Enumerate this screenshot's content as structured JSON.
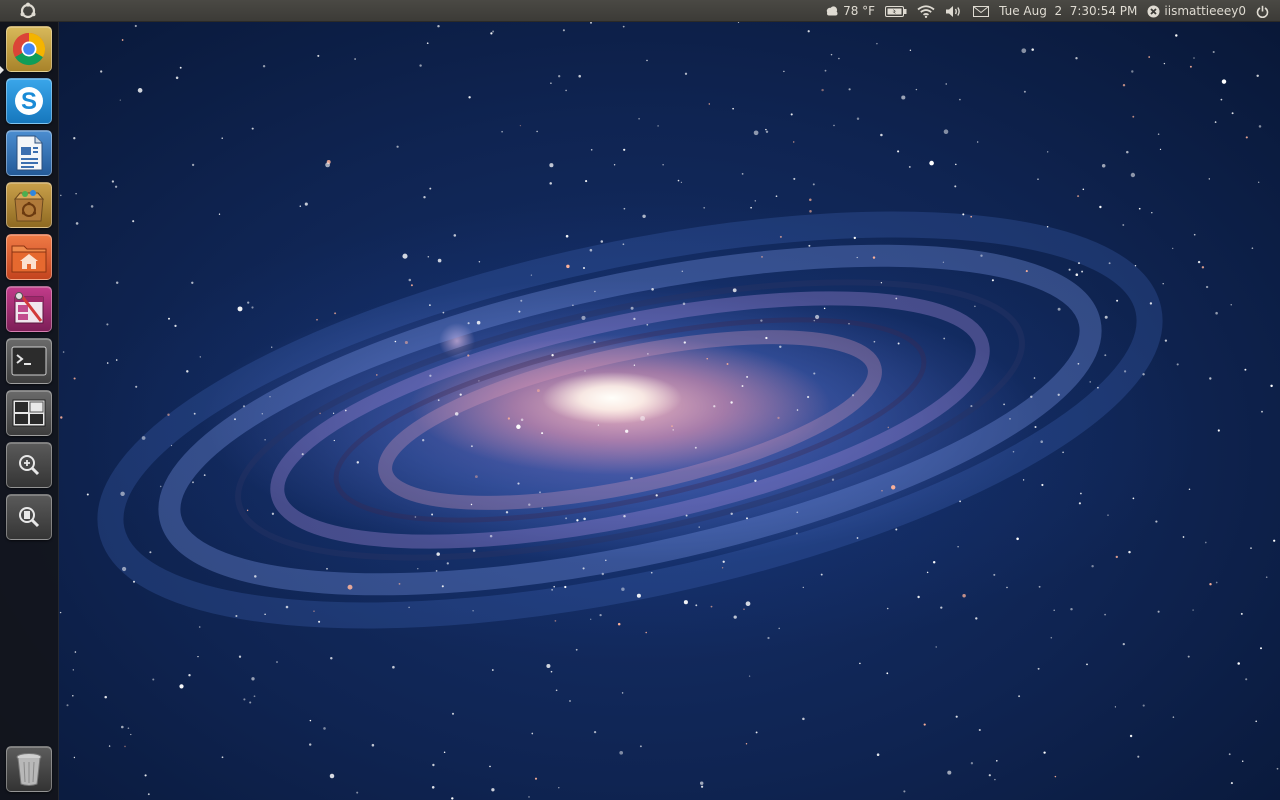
{
  "panel": {
    "weather_temp": "78 °F",
    "datetime": "Tue Aug  2  7:30:54 PM",
    "username": "iismattieeey0"
  },
  "icons": {
    "dash": "ubuntu-logo-icon",
    "weather": "weather-cloud-icon",
    "battery": "battery-icon",
    "wifi": "wifi-icon",
    "volume": "volume-icon",
    "mail": "mail-icon",
    "user_status": "user-status-icon",
    "power": "power-icon"
  },
  "launcher": {
    "items": [
      {
        "name": "chrome-launcher",
        "icon": "chrome-icon",
        "bg": "#c9a640"
      },
      {
        "name": "skype-launcher",
        "icon": "skype-icon",
        "bg": "#1c8fd6"
      },
      {
        "name": "writer-launcher",
        "icon": "document-icon",
        "bg": "#2f6fb3"
      },
      {
        "name": "software-center-launcher",
        "icon": "software-center-icon",
        "bg": "#b48a2c"
      },
      {
        "name": "home-folder-launcher",
        "icon": "home-folder-icon",
        "bg": "#d4552a"
      },
      {
        "name": "appearance-launcher",
        "icon": "appearance-icon",
        "bg": "#9c2f70"
      },
      {
        "name": "terminal-launcher",
        "icon": "terminal-icon",
        "bg": "#5c5c5c"
      },
      {
        "name": "workspace-switcher-launcher",
        "icon": "workspace-icon",
        "bg": "#5a5a5a"
      },
      {
        "name": "zoom-launcher",
        "icon": "zoom-in-icon",
        "bg": "#4c4c4c"
      },
      {
        "name": "find-files-launcher",
        "icon": "search-files-icon",
        "bg": "#4c4c4c"
      },
      {
        "name": "trash-launcher",
        "icon": "trash-icon",
        "bg": "#4a4a4a"
      }
    ]
  },
  "colors": {
    "panel_bg": "#3c3b37",
    "panel_text": "#dfdbd2",
    "launcher_bg": "#141416"
  }
}
